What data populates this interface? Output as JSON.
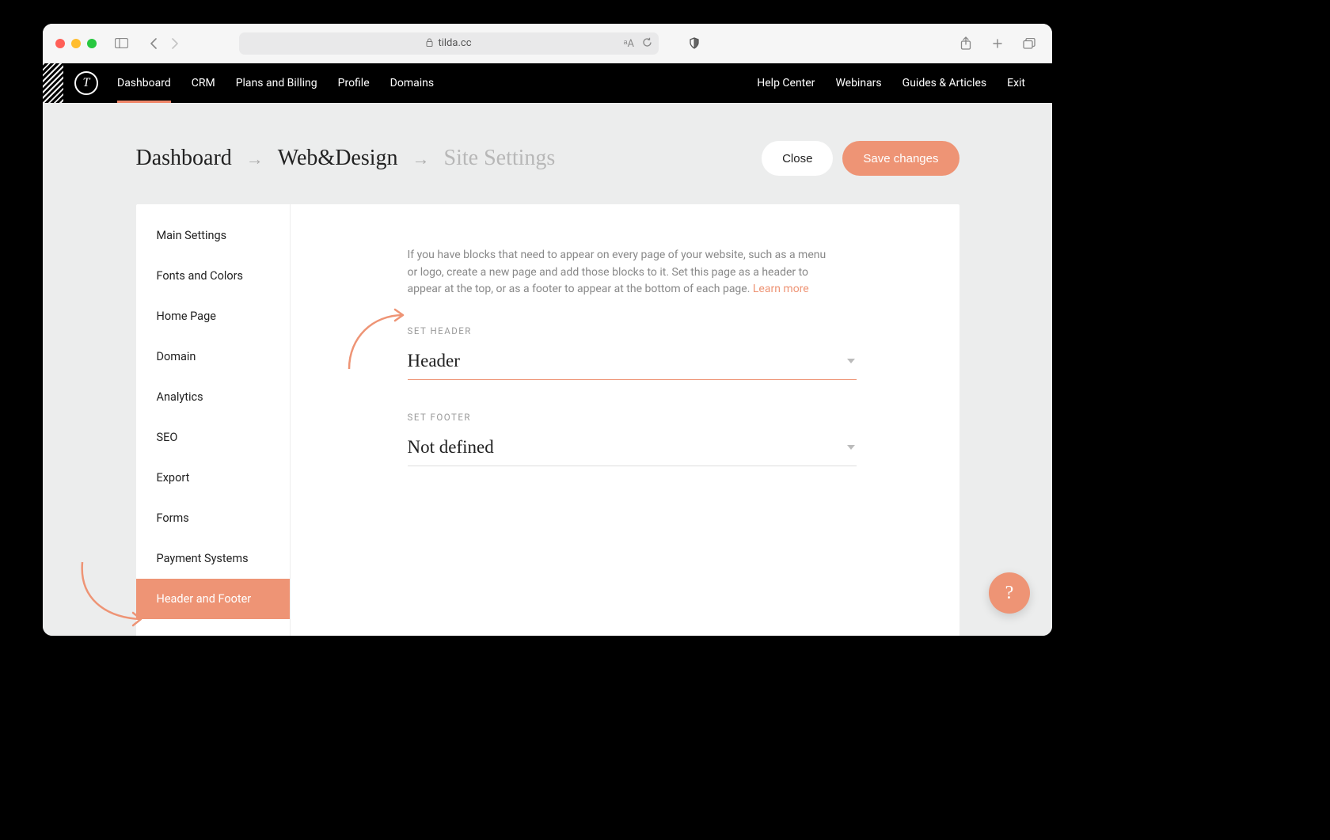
{
  "browser": {
    "url_host": "tilda.cc"
  },
  "nav": {
    "left": [
      "Dashboard",
      "CRM",
      "Plans and Billing",
      "Profile",
      "Domains"
    ],
    "right": [
      "Help Center",
      "Webinars",
      "Guides & Articles",
      "Exit"
    ],
    "logo_letter": "T"
  },
  "breadcrumb": {
    "items": [
      "Dashboard",
      "Web&Design",
      "Site Settings"
    ],
    "sep": "→"
  },
  "actions": {
    "close": "Close",
    "save": "Save changes"
  },
  "sidebar": {
    "items": [
      "Main Settings",
      "Fonts and Colors",
      "Home Page",
      "Domain",
      "Analytics",
      "SEO",
      "Export",
      "Forms",
      "Payment Systems",
      "Header and Footer"
    ],
    "active_index": 9
  },
  "content": {
    "intro": "If you have blocks that need to appear on every page of your website, such as a menu or logo, create a new page and add those blocks to it. Set this page as a header to appear at the top, or as a footer to appear at the bottom of each page. ",
    "learn_more": "Learn more",
    "header_label": "SET HEADER",
    "header_value": "Header",
    "footer_label": "SET FOOTER",
    "footer_value": "Not defined"
  },
  "help_fab": "?",
  "colors": {
    "accent": "#ee9475"
  }
}
